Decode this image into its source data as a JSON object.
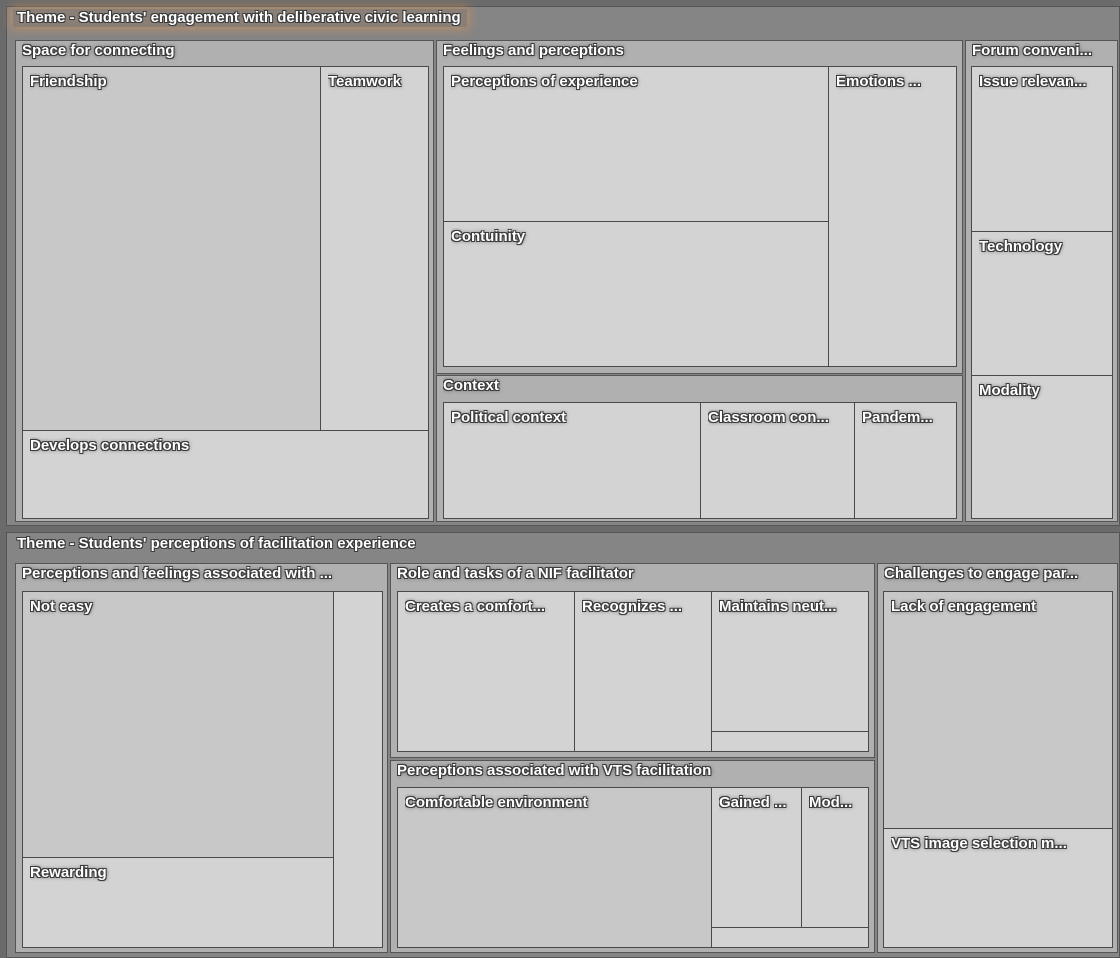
{
  "themes": [
    {
      "title": "Theme - Students' engagement with deliberative civic learning",
      "groups": [
        {
          "label": "Space for connecting",
          "leaves": [
            "Friendship",
            "Teamwork",
            "Develops connections"
          ]
        },
        {
          "label": "Feelings and perceptions",
          "leaves": [
            "Perceptions of experience",
            "Emotions ...",
            "Contuinity"
          ]
        },
        {
          "label": "Context",
          "leaves": [
            "Political context",
            "Classroom con...",
            "Pandem..."
          ]
        },
        {
          "label": "Forum conveni...",
          "leaves": [
            "Issue relevan...",
            "Technology",
            "Modality"
          ]
        }
      ]
    },
    {
      "title": "Theme - Students' perceptions of facilitation experience",
      "groups": [
        {
          "label": "Perceptions and feelings associated with ...",
          "leaves": [
            "Not easy",
            "Rewarding",
            ""
          ]
        },
        {
          "label": "Role and tasks of a NIF facilitator",
          "leaves": [
            "Creates a comfort...",
            "Recognizes ...",
            "Maintains neut...",
            ""
          ]
        },
        {
          "label": "Perceptions associated with VTS facilitation",
          "leaves": [
            "Comfortable environment",
            "Gained ...",
            "Mod...",
            ""
          ]
        },
        {
          "label": "Challenges to engage par...",
          "leaves": [
            "Lack of engagement",
            "VTS image selection m..."
          ]
        }
      ]
    }
  ]
}
